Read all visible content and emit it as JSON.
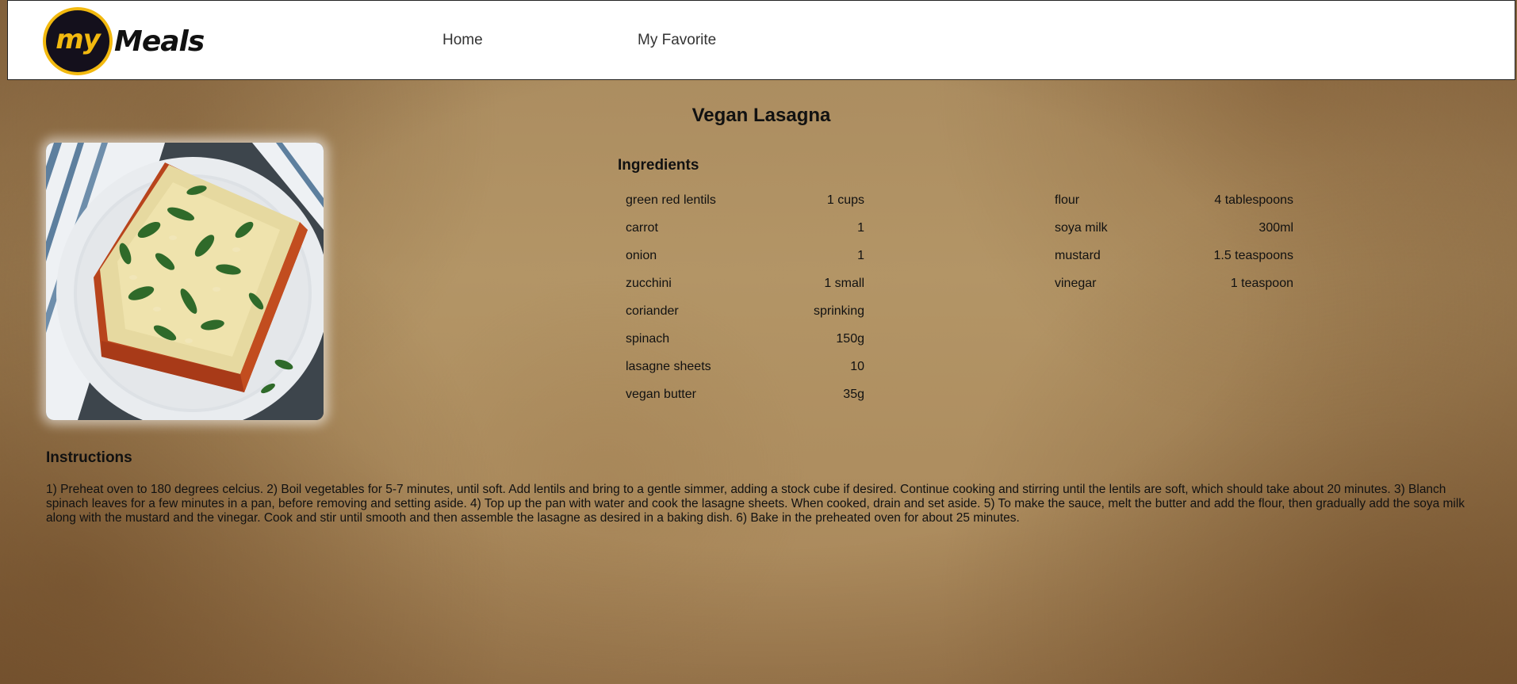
{
  "nav": {
    "logo_my": "my",
    "logo_meals": "Meals",
    "links": [
      "Home",
      "My Favorite"
    ]
  },
  "recipe": {
    "title": "Vegan Lasagna",
    "ingredients_heading": "Ingredients",
    "ingredients_left": [
      {
        "name": "green red lentils",
        "qty": "1 cups"
      },
      {
        "name": "carrot",
        "qty": "1"
      },
      {
        "name": "onion",
        "qty": "1"
      },
      {
        "name": "zucchini",
        "qty": "1 small"
      },
      {
        "name": "coriander",
        "qty": "sprinking"
      },
      {
        "name": "spinach",
        "qty": "150g"
      },
      {
        "name": "lasagne sheets",
        "qty": "10"
      },
      {
        "name": "vegan butter",
        "qty": "35g"
      }
    ],
    "ingredients_right": [
      {
        "name": "flour",
        "qty": "4 tablespoons"
      },
      {
        "name": "soya milk",
        "qty": "300ml"
      },
      {
        "name": "mustard",
        "qty": "1.5 teaspoons"
      },
      {
        "name": "vinegar",
        "qty": "1 teaspoon"
      }
    ],
    "instructions_heading": "Instructions",
    "instructions": "1) Preheat oven to 180 degrees celcius. 2) Boil vegetables for 5-7 minutes, until soft. Add lentils and bring to a gentle simmer, adding a stock cube if desired. Continue cooking and stirring until the lentils are soft, which should take about 20 minutes. 3) Blanch spinach leaves for a few minutes in a pan, before removing and setting aside. 4) Top up the pan with water and cook the lasagne sheets. When cooked, drain and set aside. 5) To make the sauce, melt the butter and add the flour, then gradually add the soya milk along with the mustard and the vinegar. Cook and stir until smooth and then assemble the lasagne as desired in a baking dish. 6) Bake in the preheated oven for about 25 minutes."
  },
  "colors": {
    "logo_yellow": "#f2b90f",
    "logo_dark": "#14101c"
  }
}
